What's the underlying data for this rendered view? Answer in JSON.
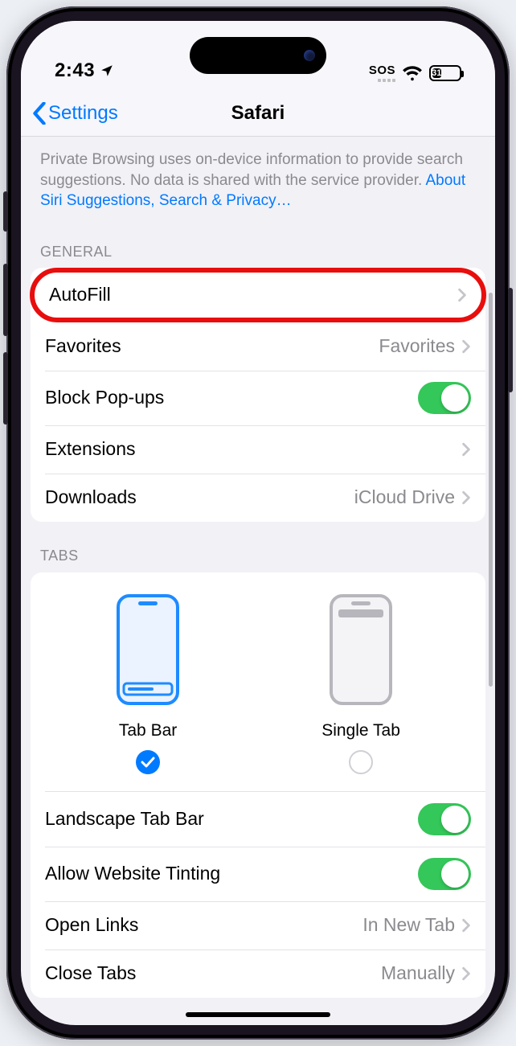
{
  "status": {
    "time": "2:43",
    "sos_label": "SOS",
    "battery_pct": "31"
  },
  "nav": {
    "back": "Settings",
    "title": "Safari"
  },
  "desc": {
    "text": "Private Browsing uses on-device information to provide search suggestions. No data is shared with the service provider. ",
    "link": "About Siri Suggestions, Search & Privacy…"
  },
  "sections": {
    "general": {
      "header": "GENERAL",
      "rows": {
        "autofill": {
          "label": "AutoFill"
        },
        "favorites": {
          "label": "Favorites",
          "value": "Favorites"
        },
        "blockpop": {
          "label": "Block Pop-ups",
          "on": true
        },
        "extensions": {
          "label": "Extensions"
        },
        "downloads": {
          "label": "Downloads",
          "value": "iCloud Drive"
        }
      }
    },
    "tabs": {
      "header": "TABS",
      "options": {
        "tabbar": {
          "label": "Tab Bar",
          "selected": true
        },
        "singletab": {
          "label": "Single Tab",
          "selected": false
        }
      },
      "rows": {
        "landscape": {
          "label": "Landscape Tab Bar",
          "on": true
        },
        "tinting": {
          "label": "Allow Website Tinting",
          "on": true
        },
        "openlinks": {
          "label": "Open Links",
          "value": "In New Tab"
        },
        "closetabs": {
          "label": "Close Tabs",
          "value": "Manually"
        }
      }
    }
  },
  "colors": {
    "link": "#007aff",
    "toggle_on": "#34c759",
    "highlight": "#e80e0e"
  }
}
